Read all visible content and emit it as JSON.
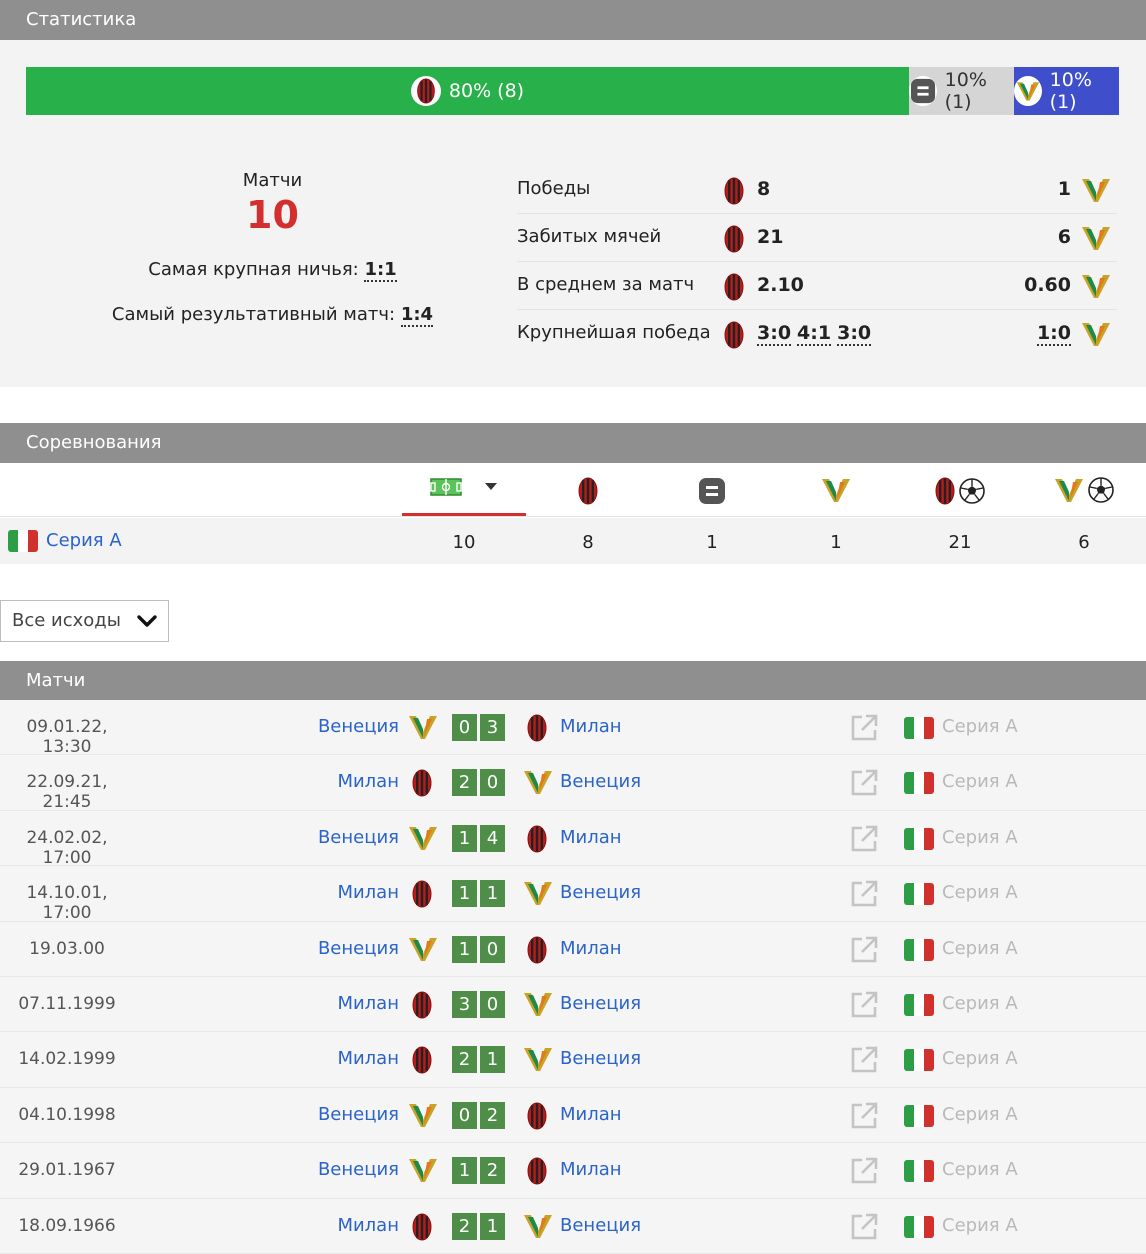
{
  "colors": {
    "home_bar": "#28b04a",
    "draw_bar": "#d5d5d5",
    "away_bar": "#3f4fcc",
    "header": "#8f8f8f",
    "score_box": "#4f8e48",
    "link": "#2a63c9",
    "accent_red": "#d32f2f"
  },
  "statistics": {
    "title": "Статистика",
    "bar": [
      {
        "key": "home",
        "text": "80% (8)",
        "fraction": 0.8,
        "icon": "milan-logo-icon"
      },
      {
        "key": "draw",
        "text": "10% (1)",
        "fraction": 0.1,
        "icon": "draw-icon"
      },
      {
        "key": "away",
        "text": "10% (1)",
        "fraction": 0.1,
        "icon": "venezia-logo-icon"
      }
    ],
    "matches_label": "Матчи",
    "matches_total": "10",
    "biggest_draw_label": "Самая крупная ничья:",
    "biggest_draw_value": "1:1",
    "top_scoring_label": "Самый результативный матч:",
    "top_scoring_value": "1:4",
    "rows": [
      {
        "label": "Победы",
        "home": "8",
        "away": "1"
      },
      {
        "label": "Забитых мячей",
        "home": "21",
        "away": "6"
      },
      {
        "label": "В среднем за матч",
        "home": "2.10",
        "away": "0.60"
      },
      {
        "label": "Крупнейшая победа",
        "home_scores": [
          "3:0",
          "4:1",
          "3:0"
        ],
        "away_scores": [
          "1:0"
        ]
      }
    ]
  },
  "competitions": {
    "title": "Соревнования",
    "columns": [
      "matches-field-icon",
      "milan-logo-icon",
      "draw-icon",
      "venezia-logo-icon",
      "milan-goals-icon",
      "venezia-goals-icon"
    ],
    "rows": [
      {
        "name": "Серия А",
        "values": [
          "10",
          "8",
          "1",
          "1",
          "21",
          "6"
        ]
      }
    ]
  },
  "filter": {
    "selected": "Все исходы"
  },
  "matches": {
    "title": "Матчи",
    "rows": [
      {
        "date": "09.01.22, 13:30",
        "home": "Венеция",
        "home_team": "venezia",
        "away": "Милан",
        "away_team": "milan",
        "score": [
          "0",
          "3"
        ],
        "league": "Серия А"
      },
      {
        "date": "22.09.21, 21:45",
        "home": "Милан",
        "home_team": "milan",
        "away": "Венеция",
        "away_team": "venezia",
        "score": [
          "2",
          "0"
        ],
        "league": "Серия А"
      },
      {
        "date": "24.02.02, 17:00",
        "home": "Венеция",
        "home_team": "venezia",
        "away": "Милан",
        "away_team": "milan",
        "score": [
          "1",
          "4"
        ],
        "league": "Серия А"
      },
      {
        "date": "14.10.01, 17:00",
        "home": "Милан",
        "home_team": "milan",
        "away": "Венеция",
        "away_team": "venezia",
        "score": [
          "1",
          "1"
        ],
        "league": "Серия А"
      },
      {
        "date": "19.03.00",
        "home": "Венеция",
        "home_team": "venezia",
        "away": "Милан",
        "away_team": "milan",
        "score": [
          "1",
          "0"
        ],
        "league": "Серия А"
      },
      {
        "date": "07.11.1999",
        "home": "Милан",
        "home_team": "milan",
        "away": "Венеция",
        "away_team": "venezia",
        "score": [
          "3",
          "0"
        ],
        "league": "Серия А"
      },
      {
        "date": "14.02.1999",
        "home": "Милан",
        "home_team": "milan",
        "away": "Венеция",
        "away_team": "venezia",
        "score": [
          "2",
          "1"
        ],
        "league": "Серия А"
      },
      {
        "date": "04.10.1998",
        "home": "Венеция",
        "home_team": "venezia",
        "away": "Милан",
        "away_team": "milan",
        "score": [
          "0",
          "2"
        ],
        "league": "Серия А"
      },
      {
        "date": "29.01.1967",
        "home": "Венеция",
        "home_team": "venezia",
        "away": "Милан",
        "away_team": "milan",
        "score": [
          "1",
          "2"
        ],
        "league": "Серия А"
      },
      {
        "date": "18.09.1966",
        "home": "Милан",
        "home_team": "milan",
        "away": "Венеция",
        "away_team": "venezia",
        "score": [
          "2",
          "1"
        ],
        "league": "Серия А"
      }
    ]
  }
}
